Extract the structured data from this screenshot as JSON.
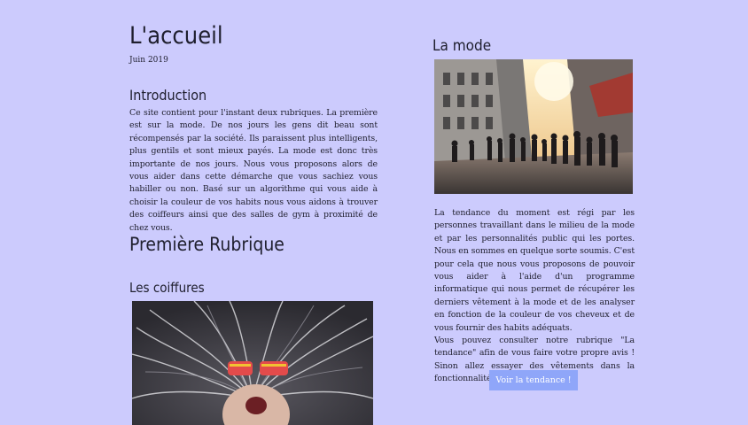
{
  "header": {
    "title": "L'accueil",
    "date": "Juin 2019"
  },
  "introduction": {
    "title": "Introduction",
    "text": "Ce site contient pour l'instant deux rubriques. La première est sur la mode. De nos jours les gens dit beau sont récompensés par la société. Ils paraissent plus intelligents, plus gentils et sont mieux payés. La mode est donc très importante de nos jours. Nous vous proposons alors de vous aider dans cette démarche que vous sachiez vous habiller ou non. Basé sur un algorithme qui vous aide à choisir la couleur de vos habits nous vous aidons à trouver des coiffeurs ainsi que des salles de gym à proximité de chez vous."
  },
  "rubrique1": {
    "title": "Première Rubrique",
    "coiffures_title": "Les coiffures"
  },
  "mode": {
    "title": "La mode",
    "paragraph1": "La tendance du moment est régi par les personnes travaillant dans le milieu de la mode et par les personnalités public qui les portes. Nous en sommes en quelque sorte soumis. C'est pour cela que nous vous proposons de pouvoir vous aider à l'aide d'un programme informatique qui nous permet de récupérer les derniers vêtement à la mode et de les analyser en fonction de la couleur de vos cheveux et de vous fournir des habits adéquats.",
    "paragraph2": "Vous pouvez consulter notre rubrique \"La tendance\" afin de vous faire votre propre avis ! Sinon allez essayer des vêtements dans la fonctionnalité \"Mes habits\".",
    "button_label": "Voir la tendance !"
  },
  "colors": {
    "background": "#cccbfd",
    "button": "#8fa6f9"
  }
}
